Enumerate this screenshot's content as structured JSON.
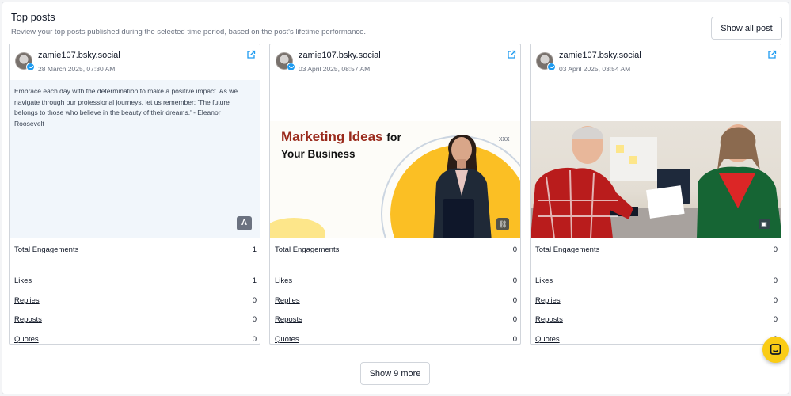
{
  "section": {
    "title": "Top posts",
    "subtitle": "Review your top posts published during the selected time period, based on the post's lifetime performance.",
    "show_all_label": "Show all post",
    "show_more_label": "Show 9 more"
  },
  "metric_labels": {
    "total": "Total Engagements",
    "likes": "Likes",
    "replies": "Replies",
    "reposts": "Reposts",
    "quotes": "Quotes"
  },
  "posts": [
    {
      "handle": "zamie107.bsky.social",
      "date": "28 March 2025, 07:30 AM",
      "text": "Embrace each day with the determination to make a positive impact. As we navigate through our professional journeys, let us remember: 'The future belongs to those who believe in the beauty of their dreams.' - Eleanor Roosevelt",
      "type_badge": "A",
      "metrics": {
        "total": "1",
        "likes": "1",
        "replies": "0",
        "reposts": "0",
        "quotes": "0"
      }
    },
    {
      "handle": "zamie107.bsky.social",
      "date": "03 April 2025, 08:57 AM",
      "image_text": {
        "line1_red": "Marketing Ideas",
        "line1_black": "for",
        "line2": "Your Business",
        "mark": "xxx"
      },
      "metrics": {
        "total": "0",
        "likes": "0",
        "replies": "0",
        "reposts": "0",
        "quotes": "0"
      }
    },
    {
      "handle": "zamie107.bsky.social",
      "date": "03 April 2025, 03:54 AM",
      "metrics": {
        "total": "0",
        "likes": "0",
        "replies": "0",
        "reposts": "0",
        "quotes": "0"
      }
    }
  ],
  "icons": {
    "external": "external-link-icon",
    "bluesky": "bluesky-icon",
    "link": "link-icon",
    "image": "image-icon",
    "chat": "chat-icon"
  },
  "colors": {
    "accent_blue": "#1d9bf0",
    "chat_yellow": "#facc15",
    "marketing_red": "#9a2a1c",
    "marketing_yellow": "#fbbf24"
  }
}
